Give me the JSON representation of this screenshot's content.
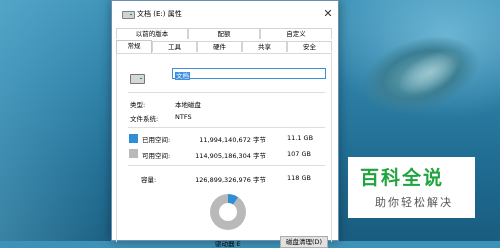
{
  "window": {
    "title": "文档 (E:) 属性",
    "close_glyph": "✕"
  },
  "tabs_row1": [
    {
      "label": "以前的版本"
    },
    {
      "label": "配额"
    },
    {
      "label": "自定义"
    }
  ],
  "tabs_row2": [
    {
      "label": "常规",
      "active": true
    },
    {
      "label": "工具"
    },
    {
      "label": "硬件"
    },
    {
      "label": "共享"
    },
    {
      "label": "安全"
    }
  ],
  "general": {
    "name_value": "文档",
    "type_label": "类型:",
    "type_value": "本地磁盘",
    "fs_label": "文件系统:",
    "fs_value": "NTFS",
    "used": {
      "label": "已用空间:",
      "bytes": "11,994,140,672 字节",
      "human": "11.1 GB",
      "color": "#2f8fd5"
    },
    "free": {
      "label": "可用空间:",
      "bytes": "114,905,186,304 字节",
      "human": "107 GB",
      "color": "#b9b9b9"
    },
    "capacity": {
      "label": "容量:",
      "bytes": "126,899,326,976 字节",
      "human": "118 GB"
    },
    "used_fraction": 0.0945,
    "drive_label": "驱动器 E",
    "cleanup_label": "磁盘清理(D)"
  },
  "watermark": {
    "title": "百科全说",
    "subtitle": "助你轻松解决"
  }
}
